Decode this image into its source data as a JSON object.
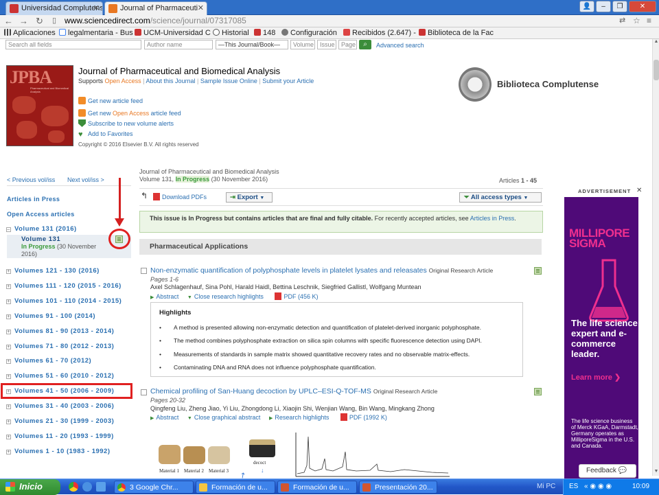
{
  "browser": {
    "tabs": [
      {
        "label": "Universidad Complutense",
        "active": false
      },
      {
        "label": "Journal of Pharmaceuti",
        "active": true
      }
    ],
    "url_host": "www.sciencedirect.com",
    "url_path": "/science/journal/07317085",
    "bookmarks": [
      "Aplicaciones",
      "legalmentaria - Bus",
      "UCM-Universidad C",
      "Historial",
      "148",
      "Configuración",
      "Recibidos (2.647) -",
      "Biblioteca de la Fac"
    ]
  },
  "search": {
    "all_fields_placeholder": "Search all fields",
    "author_placeholder": "Author name",
    "scope_value": "—This Journal/Book—",
    "volume_placeholder": "Volume",
    "issue_placeholder": "Issue",
    "page_placeholder": "Page",
    "advanced_label": "Advanced search"
  },
  "journal": {
    "title": "Journal of Pharmaceutical and Biomedical Analysis",
    "supports_label": "Supports",
    "open_access": "Open Access",
    "links": [
      "About this Journal",
      "Sample Issue Online",
      "Submit your Article"
    ],
    "feed_article": "Get new article feed",
    "feed_oa_prefix": "Get new",
    "feed_oa_mid": "Open Access",
    "feed_oa_suffix": "article feed",
    "alerts": "Subscribe to new volume alerts",
    "favorites": "Add to Favorites",
    "copyright": "Copyright © 2016 Elsevier B.V. All rights reserved",
    "cover_logo": "JPBA",
    "cover_sub": "Pharmaceutical and Biomedical Analysis",
    "library_name": "Biblioteca Complutense"
  },
  "leftnav": {
    "prev": "< Previous vol/iss",
    "next": "Next vol/iss >",
    "articles_in_press": "Articles in Press",
    "open_access": "Open Access articles",
    "current_volume_group": "Volume 131 (2016)",
    "selected_volume": "Volume 131",
    "selected_status": "In Progress",
    "selected_date1": "(30 November",
    "selected_date2": "2016)",
    "volumes": [
      "Volumes 121 - 130 (2016)",
      "Volumes 111 - 120 (2015 - 2016)",
      "Volumes 101 - 110 (2014 - 2015)",
      "Volumes 91 - 100 (2014)",
      "Volumes 81 - 90 (2013 - 2014)",
      "Volumes 71 - 80 (2012 - 2013)",
      "Volumes 61 - 70 (2012)",
      "Volumes 51 - 60 (2010 - 2012)",
      "Volumes 41 - 50 (2006 - 2009)",
      "Volumes 31 - 40 (2003 - 2006)",
      "Volumes 21 - 30 (1999 - 2003)",
      "Volumes 11 - 20 (1993 - 1999)",
      "Volumes 1 - 10 (1983 - 1992)"
    ]
  },
  "issue": {
    "journal_line": "Journal of Pharmaceutical and Biomedical Analysis",
    "volume": "Volume 131,",
    "status": "In Progress",
    "date": "(30 November 2016)",
    "articles_label": "Articles",
    "articles_range": "1 - 45",
    "download_pdfs": "Download PDFs",
    "export": "Export",
    "access_filter": "All access types",
    "notice_bold": "This issue is In Progress but contains articles that are final and fully citable.",
    "notice_rest": "For recently accepted articles, see",
    "notice_link": "Articles in Press",
    "notice_end": ".",
    "section": "Pharmaceutical Applications"
  },
  "articles": [
    {
      "title": "Non-enzymatic quantification of polyphosphate levels in platelet lysates and releasates",
      "type": "Original Research Article",
      "pages": "Pages 1-6",
      "authors": "Axel Schlagenhauf, Sina Pohl, Harald Haidl, Bettina Leschnik, Siegfried Gallistl, Wolfgang Muntean",
      "links": [
        "Abstract",
        "Close research highlights",
        "PDF (456 K)"
      ],
      "highlights_title": "Highlights",
      "highlights": [
        "A method is presented allowing non-enzymatic detection and quantification of platelet-derived inorganic polyphosphate.",
        "The method combines polyphosphate extraction on silica spin columns with specific fluorescence detection using DAPI.",
        "Measurements of standards in sample matrix showed quantitative recovery rates and no observable matrix-effects.",
        "Contaminating DNA and RNA does not influence polyphosphate quantification."
      ]
    },
    {
      "title": "Chemical profiling of San-Huang decoction by UPLC–ESI-Q-TOF-MS",
      "type": "Original Research Article",
      "pages": "Pages 20-32",
      "authors": "Qingfeng Liu, Zheng Jiao, Yi Liu, Zhongdong Li, Xiaojin Shi, Wenjian Wang, Bin Wang, Mingkang Zhong",
      "links": [
        "Abstract",
        "Close graphical abstract",
        "Research highlights",
        "PDF (1992 K)"
      ],
      "figure_labels": [
        "Material 1",
        "Material 2",
        "Material 3",
        "decoct"
      ]
    }
  ],
  "ad": {
    "label": "ADVERTISEMENT",
    "brand1": "MILLIPORE",
    "brand2": "SIGMA",
    "headline": "The life science expert and e-commerce leader.",
    "cta": "Learn more ❯",
    "small": "The life science business of Merck KGaA, Darmstadt, Germany operates as MilliporeSigma in the U.S. and Canada.",
    "feedback": "Feedback"
  },
  "taskbar": {
    "start": "Inicio",
    "items": [
      "3 Google Chr...",
      "Formación de u...",
      "Formación de u...",
      "Presentación 20..."
    ],
    "mipc": "Mi PC",
    "lang": "ES",
    "clock": "10:09"
  },
  "colors": {
    "accent": "#2a6fb1",
    "open_access": "#e87722",
    "in_progress": "#3a9a3a",
    "annotation": "#e02020"
  }
}
